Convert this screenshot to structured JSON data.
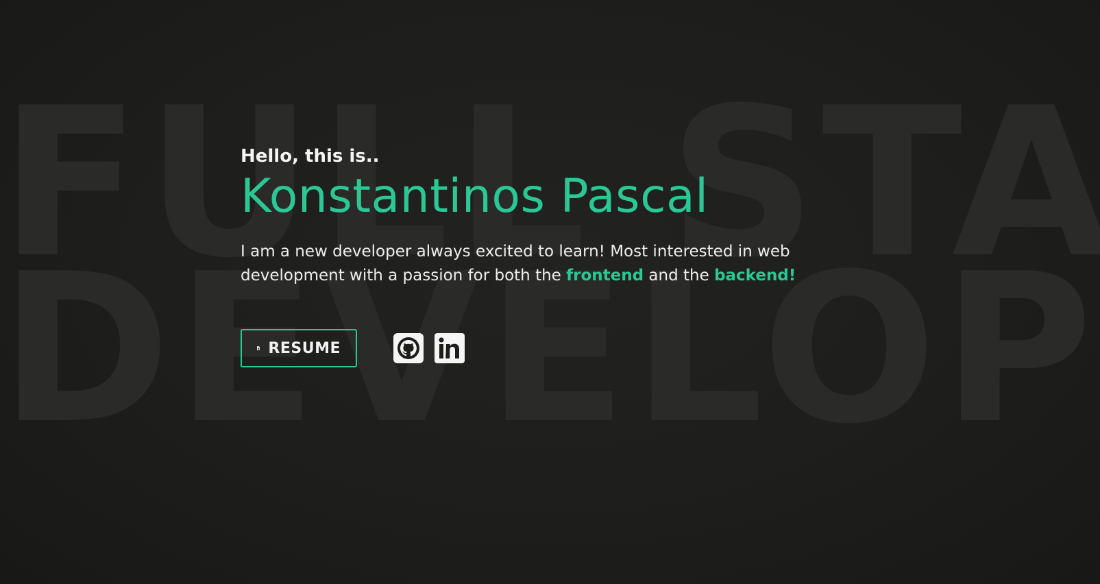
{
  "background": {
    "line1": "FULL STACK",
    "line2": "DEVELOPER"
  },
  "hero": {
    "greeting": "Hello, this is..",
    "name": "Konstantinos Pascal",
    "intro_part1": "I am a new developer always excited to learn! Most interested in web development with a passion for both the ",
    "highlight1": "frontend",
    "intro_part2": " and the ",
    "highlight2": "backend!"
  },
  "actions": {
    "resume_label": "RESUME",
    "resume_icon": "file-download-icon",
    "social": [
      {
        "icon": "github-icon"
      },
      {
        "icon": "linkedin-icon"
      }
    ]
  },
  "colors": {
    "accent": "#2bc795",
    "background": "#1d1d1b",
    "watermark": "#2a2b28",
    "text": "#f2f2f2"
  }
}
